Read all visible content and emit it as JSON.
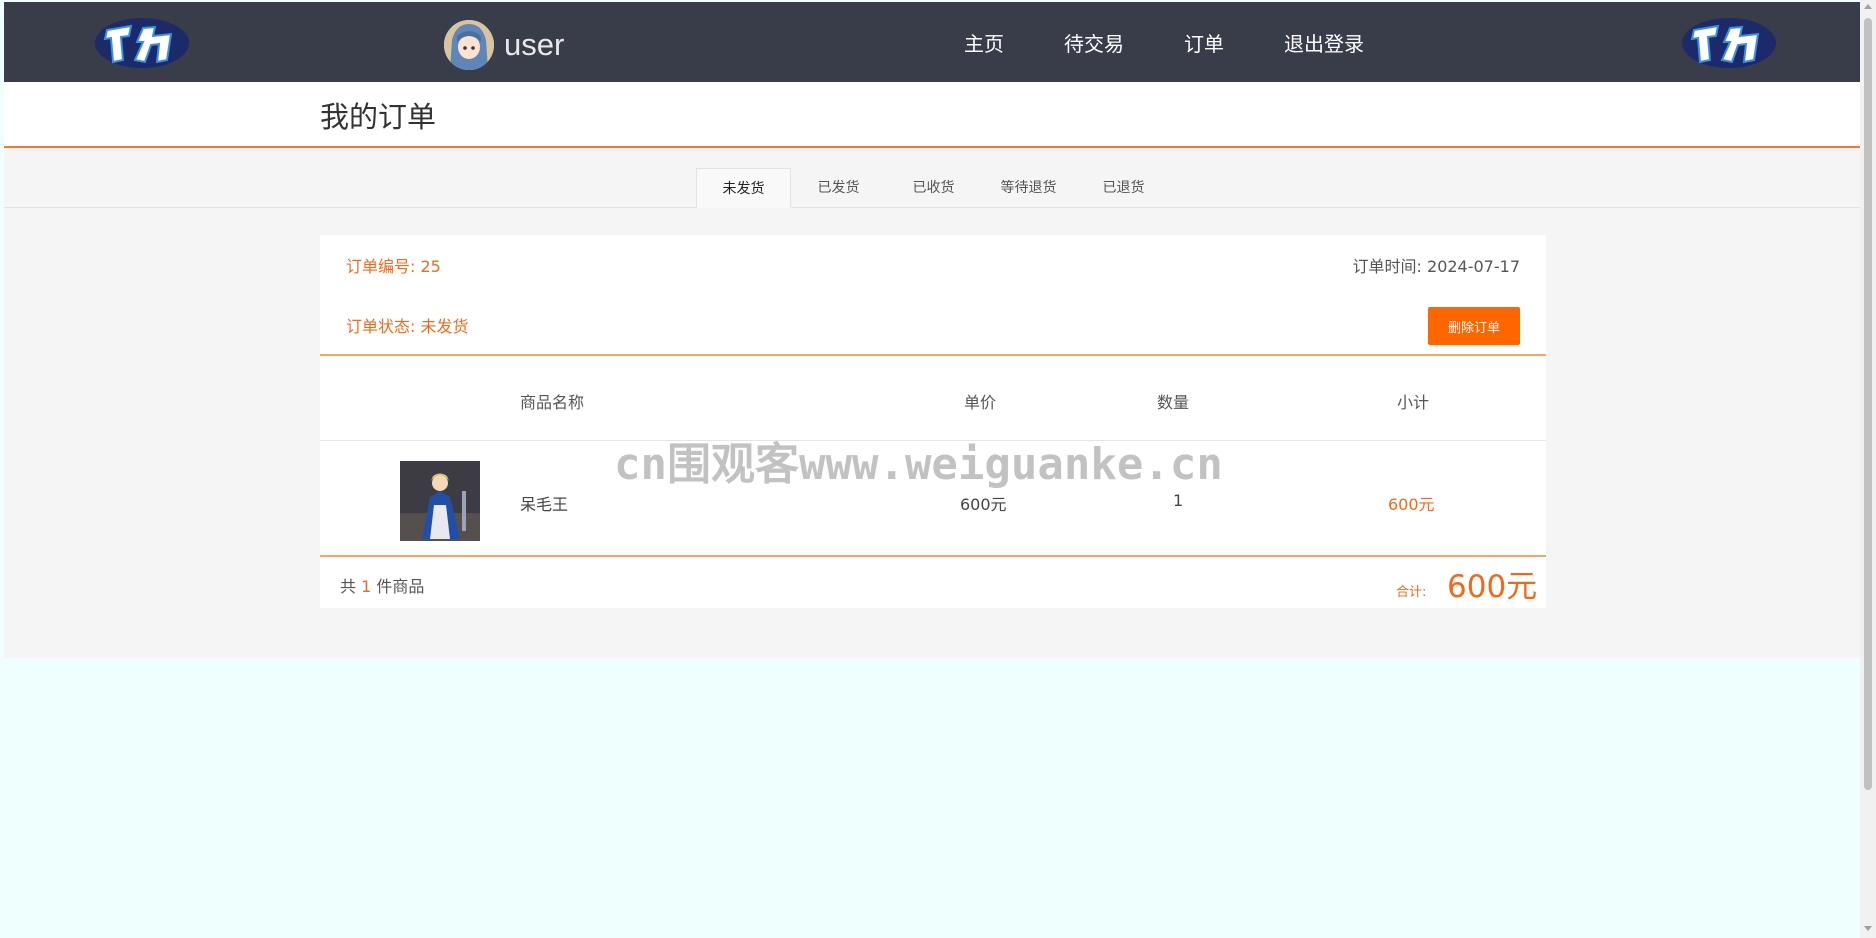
{
  "navbar": {
    "username": "user",
    "links": [
      "主页",
      "待交易",
      "订单",
      "退出登录"
    ]
  },
  "page": {
    "title": "我的订单"
  },
  "tabs": [
    "未发货",
    "已发货",
    "已收货",
    "等待退货",
    "已退货"
  ],
  "active_tab": "未发货",
  "order": {
    "number_label": "订单编号: 25",
    "time_label": "订单时间: 2024-07-17",
    "status_label": "订单状态: 未发货",
    "delete_button": "删除订单",
    "columns": {
      "name": "商品名称",
      "price": "单价",
      "qty": "数量",
      "subtotal": "小计"
    },
    "items": [
      {
        "name": "呆毛王",
        "price": "600元",
        "qty": "1",
        "subtotal": "600元"
      }
    ],
    "count_prefix": "共",
    "count": "1",
    "count_suffix": "件商品",
    "total_label": "合计:",
    "total_value": "600元"
  },
  "watermark": "cn围观客www.weiguanke.cn",
  "colors": {
    "navbar_bg": "#393d49",
    "accent": "#f06a1c",
    "button": "#ff6600",
    "page_bg": "#eefffe",
    "content_bg": "#f5f5f5"
  }
}
